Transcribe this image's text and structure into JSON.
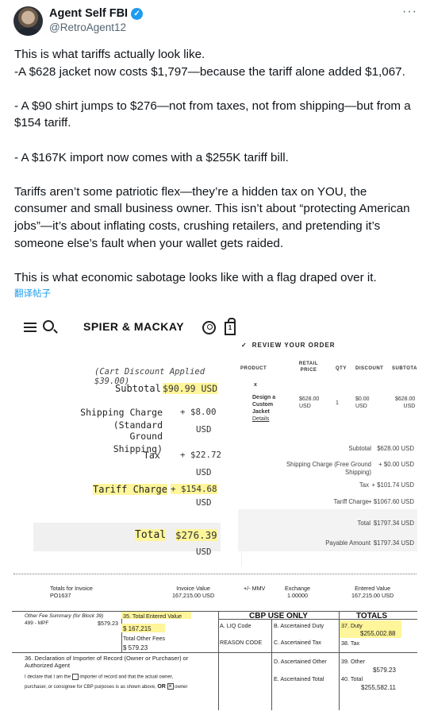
{
  "tweet": {
    "author_name": "Agent Self FBI",
    "handle": "@RetroAgent12",
    "more_icon": "more-horizontal-icon",
    "verified_icon": "verified-badge-icon",
    "paragraphs": [
      "This is what tariffs actually look like.\n-A $628 jacket now costs $1,797—because the tariff alone added $1,067.",
      "- A $90 shirt jumps to $276—not from taxes, not from shipping—but from a $154 tariff.",
      "- A $167K import now comes with a $255K tariff bill.",
      "Tariffs aren’t some patriotic flex—they’re a hidden tax on YOU, the consumer and small business owner. This isn’t about “protecting American jobs”—it’s about inflating costs, crushing retailers, and pretending it’s someone else’s fault when your wallet gets raided.",
      "This is what economic sabotage looks like with a flag draped over it."
    ],
    "translate_link": "翻译帖子"
  },
  "colors": {
    "highlight": "#fff59a",
    "link": "#1d9bf0",
    "verified": "#1d9bf0"
  },
  "shop": {
    "brand": "SPIER & MACKAY",
    "cart_count": "1",
    "cart_discount": "(Cart Discount Applied $39.00)",
    "subtotal_label": "Subtotal",
    "subtotal_value": "$90.99 USD",
    "shipping_label_1": "Shipping Charge",
    "shipping_label_2": "(Standard Ground",
    "shipping_label_3": "Shipping)",
    "shipping_value": "+ $8.00",
    "shipping_currency": "USD",
    "tax_label": "Tax",
    "tax_value": "+ $22.72",
    "tax_currency": "USD",
    "tariff_label": "Tariff Charge",
    "tariff_value": "+ $154.68",
    "tariff_currency": "USD",
    "total_label": "Total",
    "total_value": "$276.39",
    "total_currency": "USD"
  },
  "review": {
    "heading": "REVIEW YOUR ORDER",
    "columns": {
      "product": "PRODUCT",
      "retail_1": "RETAIL",
      "retail_2": "PRICE",
      "qty": "QTY",
      "discount": "DISCOUNT",
      "subtotal": "SUBTOTAL"
    },
    "item": {
      "remove": "x",
      "name_1": "Design a",
      "name_2": "Custom",
      "name_3": "Jacket",
      "details": "Details",
      "retail": "$628.00",
      "retail_cur": "USD",
      "qty": "1",
      "discount": "$0.00",
      "discount_cur": "USD",
      "subtotal": "$628.00",
      "subtotal_cur": "USD"
    },
    "subtotal_label": "Subtotal",
    "subtotal_value": "$628.00 USD",
    "shipping_label_1": "Shipping Charge (Free Ground",
    "shipping_label_2": "Shipping)",
    "shipping_value": "+ $0.00 USD",
    "tax_label": "Tax",
    "tax_value": "+ $101.74 USD",
    "tariff_label": "Tariff Charge",
    "tariff_value": "+ $1067.60 USD",
    "total_label": "Total",
    "total_value": "$1797.34 USD",
    "payable_label": "Payable Amount",
    "payable_value": "$1797.34 USD"
  },
  "cbp": {
    "totals_invoice_1": "Totals for Invoice",
    "totals_invoice_2": "PO1637",
    "invoice_value_1": "Invoice Value",
    "invoice_value_2": "167,215.00 USD",
    "mmv": "+/- MMV",
    "exchange_1": "Exchange",
    "exchange_2": "1.00000",
    "entered_1": "Entered Value",
    "entered_2": "167,215.00 USD",
    "other_fee_1": "Other Fee Summary (for Block 39)",
    "other_fee_2": "499 - MPF",
    "other_fee_amt": "$579.23",
    "b35_label": "35. Total Entered Value",
    "b35_value": "$ 167,215",
    "other_fees_label": "Total Other Fees",
    "other_fees_value": "$ 579.23",
    "cbp_only": "CBP USE ONLY",
    "totals_head": "TOTALS",
    "a_liq": "A. LIQ Code",
    "b_duty": "B. Ascertained Duty",
    "reason": "REASON CODE",
    "c_tax": "C. Ascertained Tax",
    "d_other": "D. Ascertained Other",
    "e_total": "E. Ascertained Total",
    "b37_label": "37. Duty",
    "b37_value": "$255,002.88",
    "b38_label": "38. Tax",
    "b39_label": "39. Other",
    "b39_value": "$579.23",
    "b40_label": "40. Total",
    "b40_value": "$255,582.11",
    "decl_1": "36. Declaration of Importer of Record (Owner or Purchaser) or",
    "decl_2": "Authorized Agent",
    "decl_3a": "I declare that I am the",
    "decl_3b": "importer of record and that the actual owner,",
    "decl_4a": "purchaser, or consignee for CBP purposes is as shown above,",
    "decl_4b": "OR",
    "decl_4c": "owner"
  }
}
